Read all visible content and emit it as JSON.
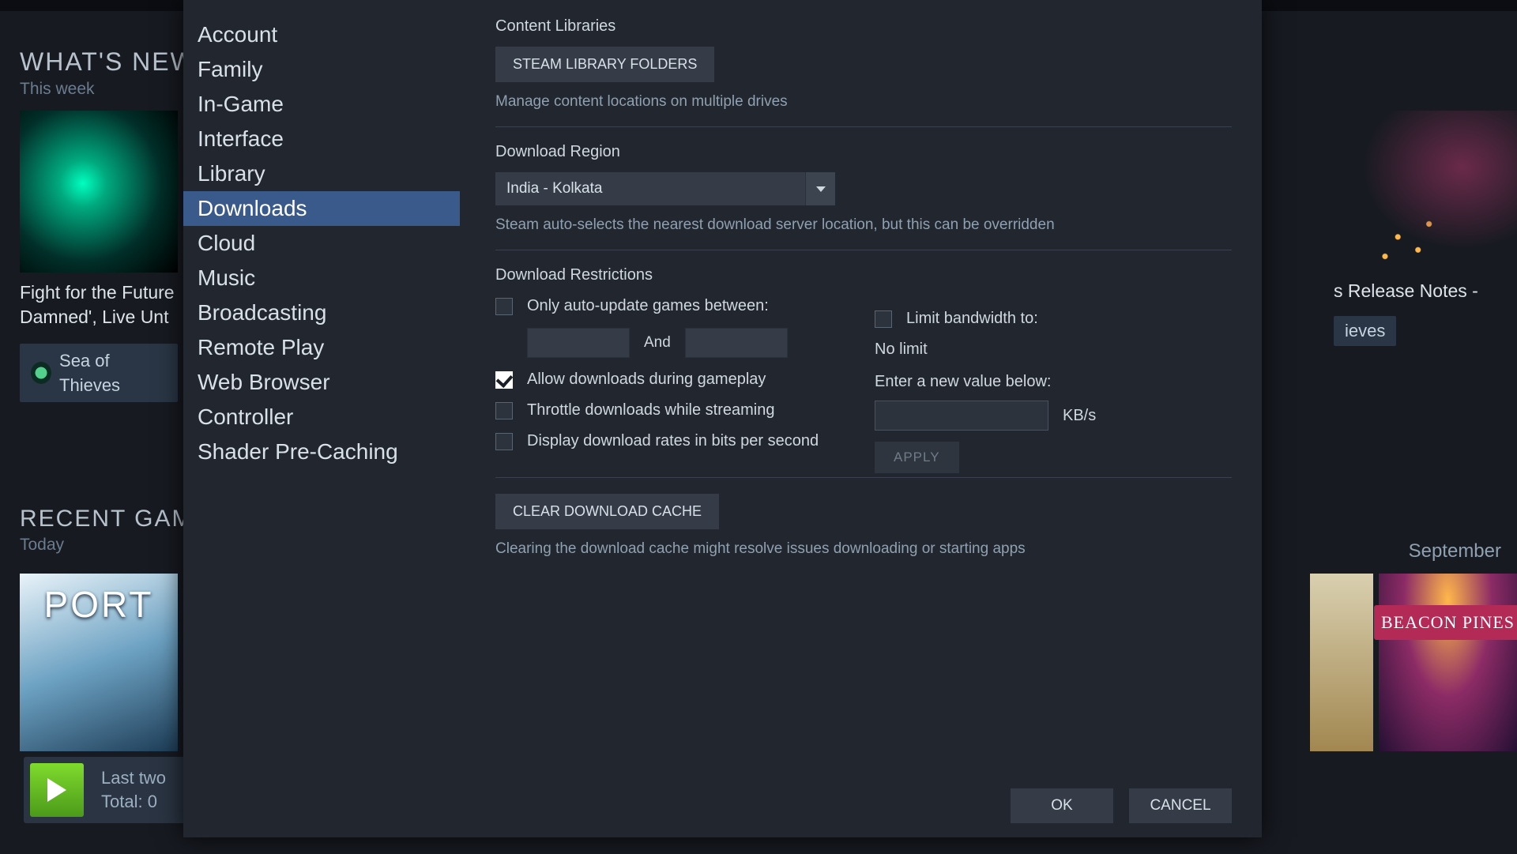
{
  "bg": {
    "whatsnew_title": "WHAT'S NEW",
    "whatsnew_sub": "This week",
    "card1_caption": "Fight for the Future\nDamned', Live Unt",
    "game1": "Sea of Thieves",
    "card2_caption": "s Release Notes -",
    "game2": "ieves",
    "recent_title": "RECENT GAM",
    "recent_sub": "Today",
    "portal_label": "PORT",
    "play_line1": "Last two",
    "play_line2": "Total: 0",
    "month": "September",
    "beacon": "BEACON PINES"
  },
  "sidebar": {
    "items": [
      {
        "label": "Account"
      },
      {
        "label": "Family"
      },
      {
        "label": "In-Game"
      },
      {
        "label": "Interface"
      },
      {
        "label": "Library"
      },
      {
        "label": "Downloads",
        "active": true
      },
      {
        "label": "Cloud"
      },
      {
        "label": "Music"
      },
      {
        "label": "Broadcasting"
      },
      {
        "label": "Remote Play"
      },
      {
        "label": "Web Browser"
      },
      {
        "label": "Controller"
      },
      {
        "label": "Shader Pre-Caching"
      }
    ]
  },
  "content": {
    "libraries_h": "Content Libraries",
    "libfolders_btn": "STEAM LIBRARY FOLDERS",
    "lib_desc": "Manage content locations on multiple drives",
    "region_h": "Download Region",
    "region_value": "India - Kolkata",
    "region_desc": "Steam auto-selects the nearest download server location, but this can be overridden",
    "restr_h": "Download Restrictions",
    "only_update": "Only auto-update games between:",
    "and": "And",
    "allow_dl": "Allow downloads during gameplay",
    "throttle": "Throttle downloads while streaming",
    "bits": "Display download rates in bits per second",
    "limit_bw": "Limit bandwidth to:",
    "nolimit": "No limit",
    "enter_val": "Enter a new value below:",
    "kbs": "KB/s",
    "apply": "APPLY",
    "clear_btn": "CLEAR DOWNLOAD CACHE",
    "clear_desc": "Clearing the download cache might resolve issues downloading or starting apps"
  },
  "footer": {
    "ok": "OK",
    "cancel": "CANCEL"
  }
}
